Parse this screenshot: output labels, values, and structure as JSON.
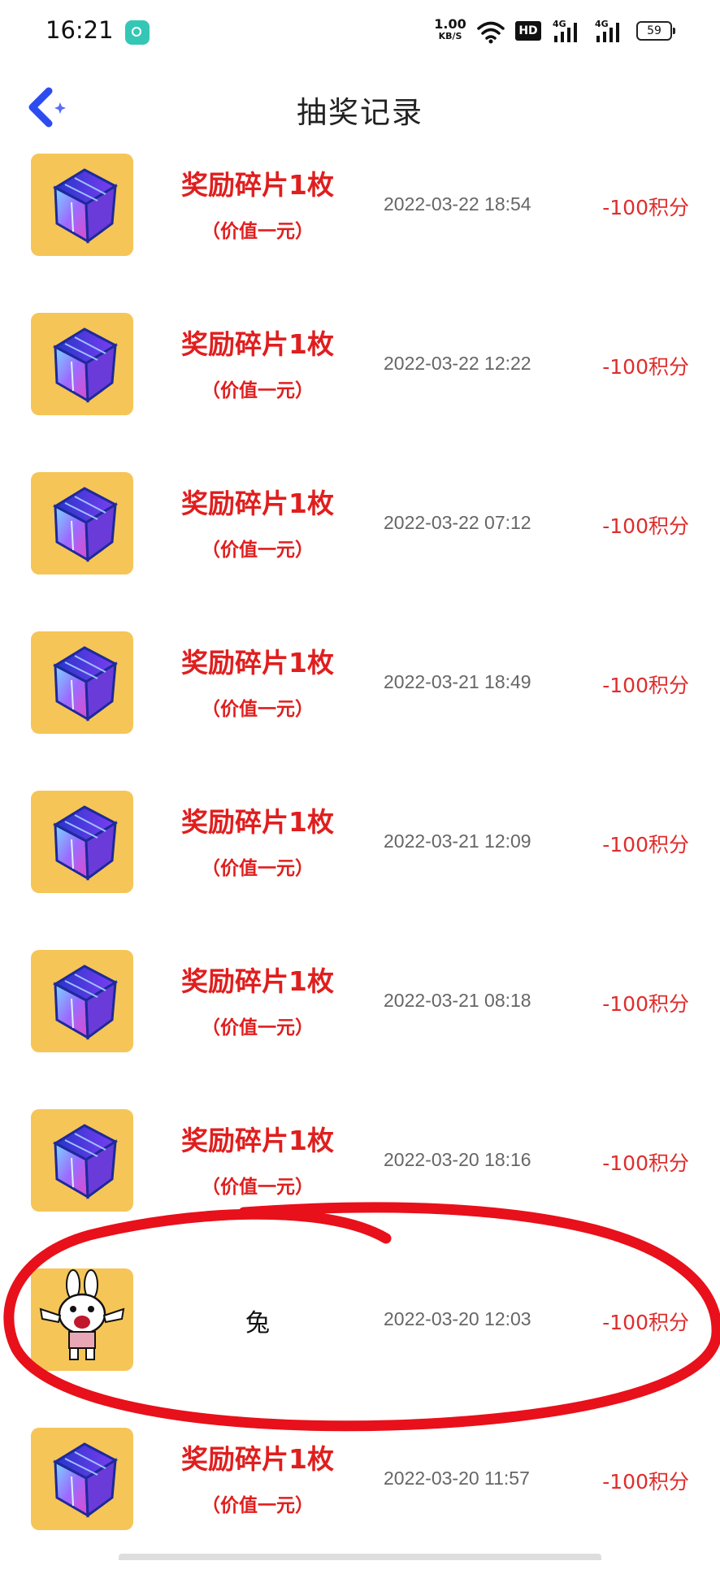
{
  "status_bar": {
    "time": "16:21",
    "net_speed": "1.00",
    "net_unit": "KB/S",
    "hd": "HD",
    "signal_1": "4G",
    "signal_2": "4G",
    "battery": "59"
  },
  "header": {
    "back_icon": "back-arrow-icon",
    "title": "抽奖记录"
  },
  "records": [
    {
      "name": "奖励碎片1枚",
      "value": "（价值一元）",
      "time": "2022-03-22 18:54",
      "points": "-100积分",
      "icon": "cube-fragment"
    },
    {
      "name": "奖励碎片1枚",
      "value": "（价值一元）",
      "time": "2022-03-22 12:22",
      "points": "-100积分",
      "icon": "cube-fragment"
    },
    {
      "name": "奖励碎片1枚",
      "value": "（价值一元）",
      "time": "2022-03-22 07:12",
      "points": "-100积分",
      "icon": "cube-fragment"
    },
    {
      "name": "奖励碎片1枚",
      "value": "（价值一元）",
      "time": "2022-03-21 18:49",
      "points": "-100积分",
      "icon": "cube-fragment"
    },
    {
      "name": "奖励碎片1枚",
      "value": "（价值一元）",
      "time": "2022-03-21 12:09",
      "points": "-100积分",
      "icon": "cube-fragment"
    },
    {
      "name": "奖励碎片1枚",
      "value": "（价值一元）",
      "time": "2022-03-21 08:18",
      "points": "-100积分",
      "icon": "cube-fragment"
    },
    {
      "name": "奖励碎片1枚",
      "value": "（价值一元）",
      "time": "2022-03-20 18:16",
      "points": "-100积分",
      "icon": "cube-fragment"
    },
    {
      "name": "兔",
      "value": "",
      "time": "2022-03-20 12:03",
      "points": "-100积分",
      "icon": "rabbit-avatar"
    },
    {
      "name": "奖励碎片1枚",
      "value": "（价值一元）",
      "time": "2022-03-20 11:57",
      "points": "-100积分",
      "icon": "cube-fragment"
    }
  ],
  "colors": {
    "accent_red": "#e01e1e",
    "thumb_bg": "#f6c557",
    "back_blue": "#2d4cf0",
    "annotation_red": "#e8101a"
  }
}
